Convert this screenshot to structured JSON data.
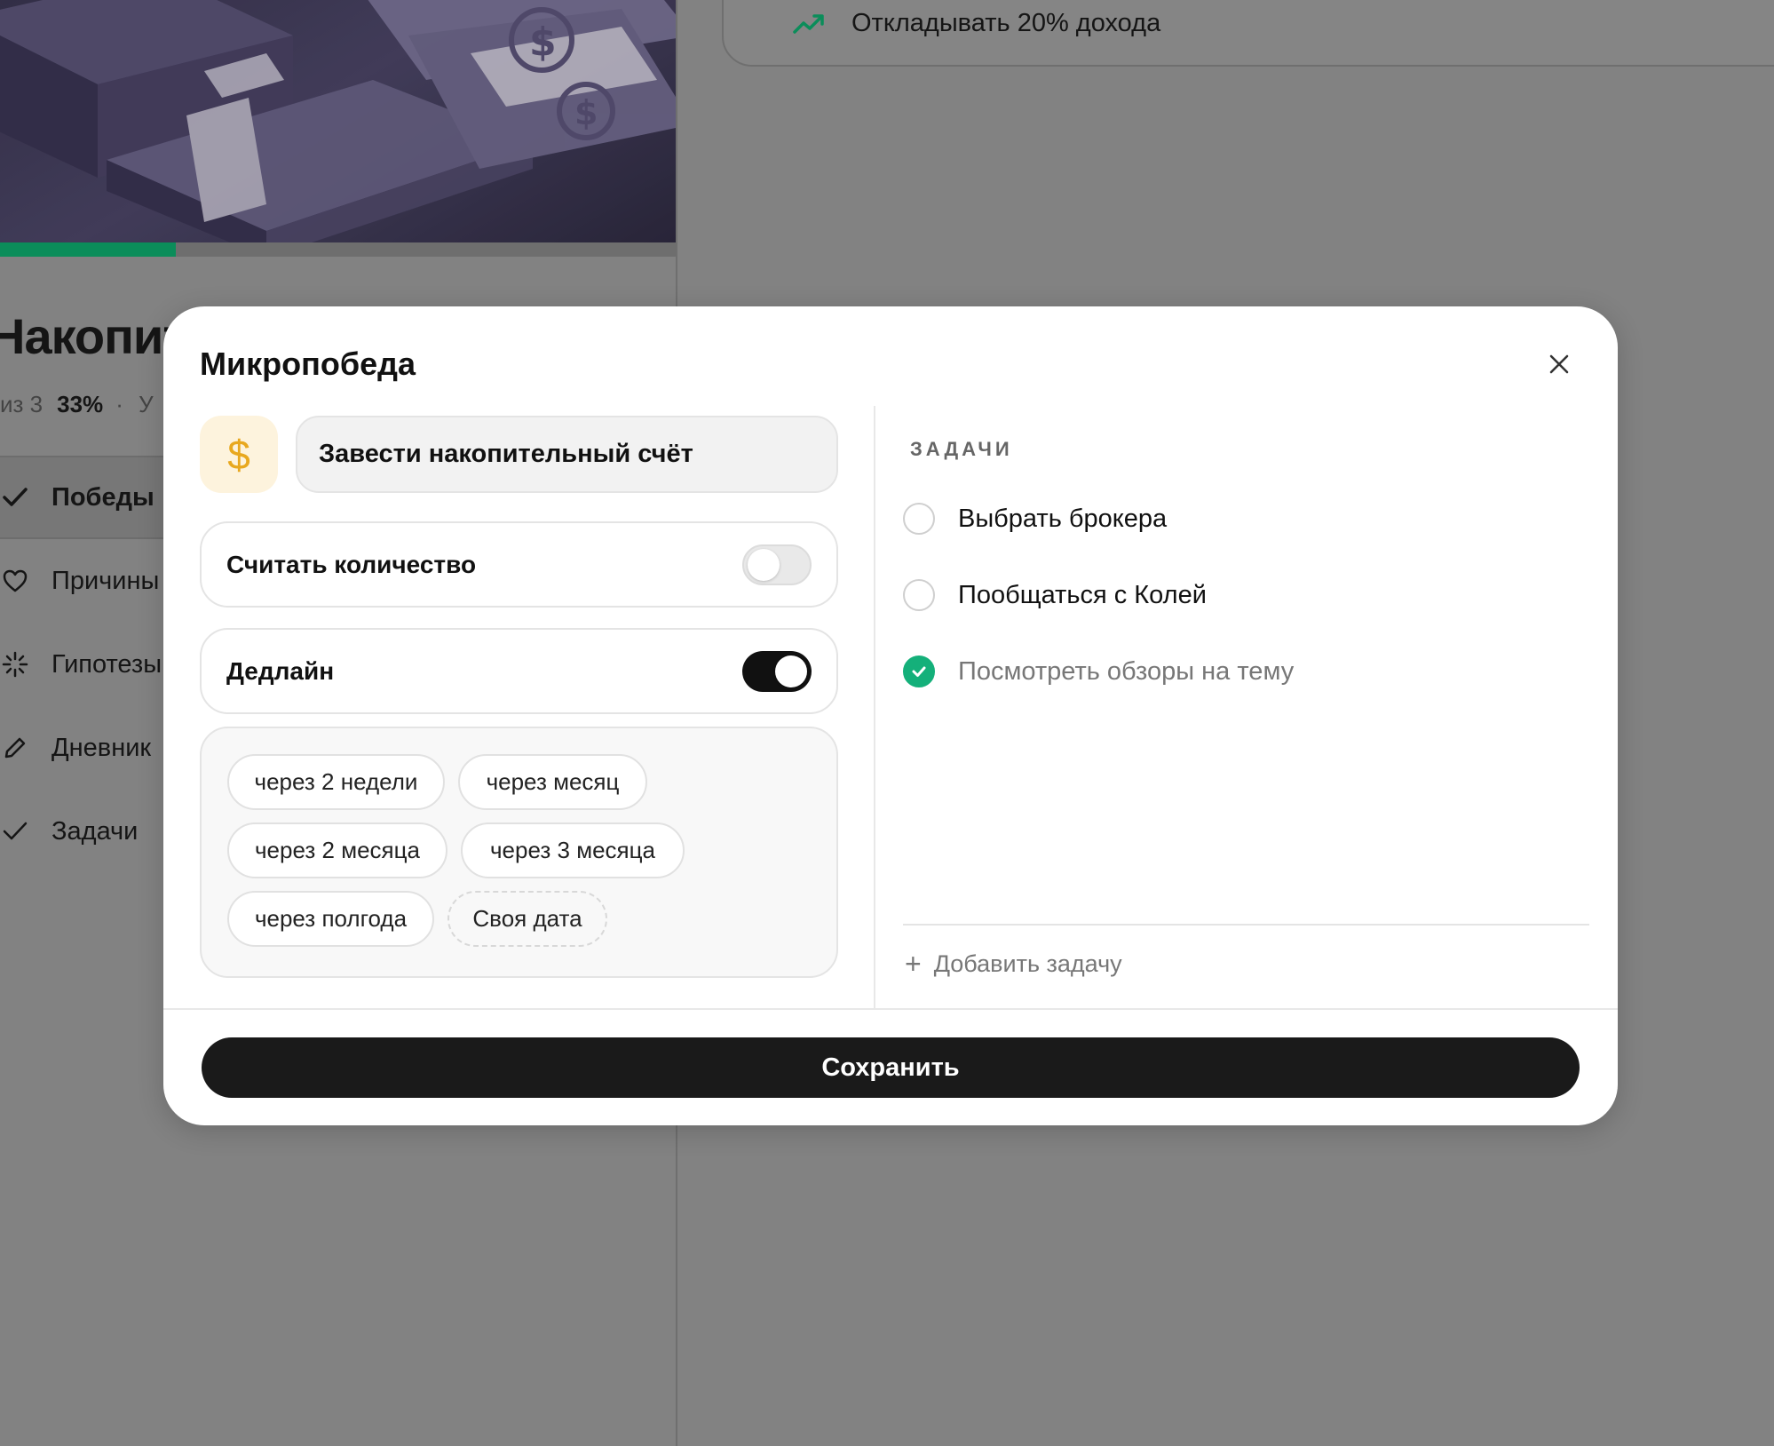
{
  "background": {
    "page_title": "Накопит",
    "meta": {
      "prefix": "из 3",
      "percent": "33%",
      "separator": "·",
      "suffix": "У"
    },
    "progress": 0.26,
    "nav": [
      {
        "label": "Победы",
        "icon": "check-icon",
        "active": true
      },
      {
        "label": "Причины",
        "icon": "heart-icon",
        "active": false
      },
      {
        "label": "Гипотезы",
        "icon": "sparkle-icon",
        "active": false
      },
      {
        "label": "Дневник",
        "icon": "pencil-icon",
        "active": false
      },
      {
        "label": "Задачи",
        "icon": "check-icon",
        "active": false
      }
    ],
    "card": {
      "text": "Откладывать 20% дохода",
      "icon": "trend-up-icon",
      "accent": "#0b8d5a"
    }
  },
  "modal": {
    "title": "Микропобеда",
    "close_icon": "close-icon",
    "icon_symbol": "$",
    "icon_color": "#e8a81f",
    "name_value": "Завести накопительный счёт",
    "count_toggle": {
      "label": "Считать количество",
      "on": false
    },
    "deadline_toggle": {
      "label": "Дедлайн",
      "on": true
    },
    "chips": [
      "через 2 недели",
      "через месяц",
      "через 2 месяца",
      "через 3 месяца",
      "через полгода",
      "Своя дата"
    ],
    "tasks_header": "ЗАДАЧИ",
    "tasks": [
      {
        "text": "Выбрать брокера",
        "done": false
      },
      {
        "text": "Пообщаться с Колей",
        "done": false
      },
      {
        "text": "Посмотреть обзоры на тему",
        "done": true
      }
    ],
    "add_task_label": "Добавить задачу",
    "save_label": "Сохранить",
    "done_color": "#14b07a"
  }
}
